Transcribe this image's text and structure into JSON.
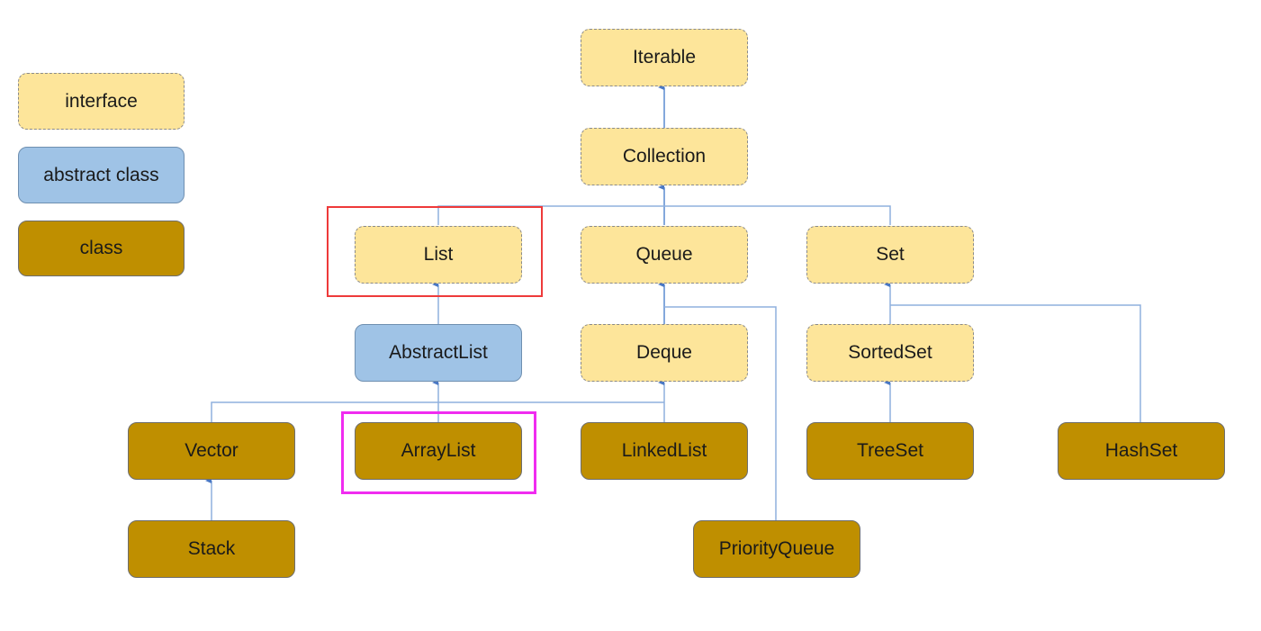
{
  "legend": {
    "interface": "interface",
    "abstract_class": "abstract class",
    "class": "class"
  },
  "nodes": {
    "iterable": {
      "label": "Iterable",
      "kind": "interface"
    },
    "collection": {
      "label": "Collection",
      "kind": "interface"
    },
    "list": {
      "label": "List",
      "kind": "interface"
    },
    "queue": {
      "label": "Queue",
      "kind": "interface"
    },
    "set": {
      "label": "Set",
      "kind": "interface"
    },
    "abstractlist": {
      "label": "AbstractList",
      "kind": "abstract class"
    },
    "deque": {
      "label": "Deque",
      "kind": "interface"
    },
    "sortedset": {
      "label": "SortedSet",
      "kind": "interface"
    },
    "vector": {
      "label": "Vector",
      "kind": "class"
    },
    "arraylist": {
      "label": "ArrayList",
      "kind": "class"
    },
    "linkedlist": {
      "label": "LinkedList",
      "kind": "class"
    },
    "treeset": {
      "label": "TreeSet",
      "kind": "class"
    },
    "hashset": {
      "label": "HashSet",
      "kind": "class"
    },
    "stack": {
      "label": "Stack",
      "kind": "class"
    },
    "priorityqueue": {
      "label": "PriorityQueue",
      "kind": "class"
    }
  },
  "edges": [
    [
      "collection",
      "iterable"
    ],
    [
      "list",
      "collection"
    ],
    [
      "queue",
      "collection"
    ],
    [
      "set",
      "collection"
    ],
    [
      "abstractlist",
      "list"
    ],
    [
      "deque",
      "queue"
    ],
    [
      "priorityqueue",
      "queue"
    ],
    [
      "sortedset",
      "set"
    ],
    [
      "hashset",
      "set"
    ],
    [
      "vector",
      "abstractlist"
    ],
    [
      "arraylist",
      "abstractlist"
    ],
    [
      "linkedlist",
      "abstractlist"
    ],
    [
      "linkedlist",
      "deque"
    ],
    [
      "stack",
      "vector"
    ],
    [
      "treeset",
      "sortedset"
    ]
  ],
  "highlights": {
    "red": "list",
    "magenta": "arraylist"
  },
  "colors": {
    "interface": "#fde59a",
    "abstract_class": "#9fc3e6",
    "class": "#bf8f00",
    "connector": "#5b8bd0",
    "highlight_red": "#ee3a3a",
    "highlight_magenta": "#f02cf0"
  }
}
